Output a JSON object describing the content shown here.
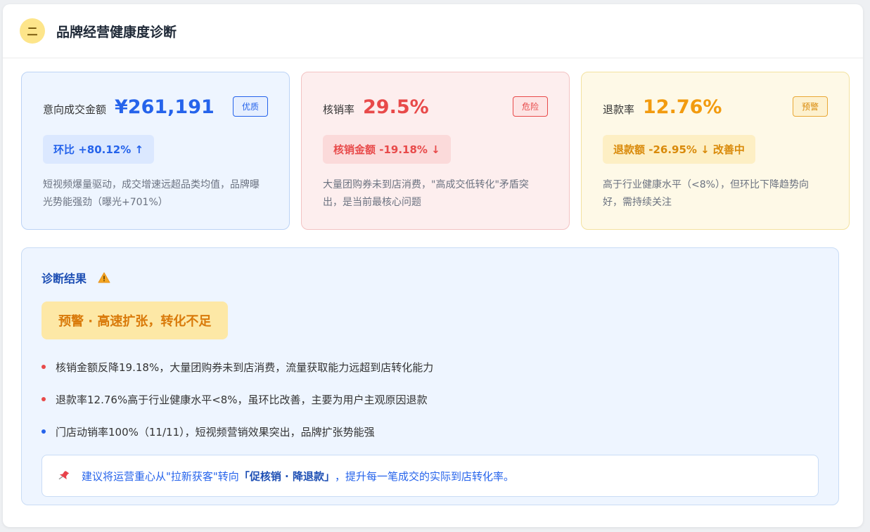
{
  "header": {
    "section_number": "二",
    "title": "品牌经营健康度诊断"
  },
  "cards": [
    {
      "label": "意向成交金额",
      "value": "¥261,191",
      "tag": "优质",
      "chip": "环比 +80.12% ↑",
      "description": "短视频爆量驱动，成交增速远超品类均值，品牌曝光势能强劲（曝光+701%）",
      "color": "#2563eb"
    },
    {
      "label": "核销率",
      "value": "29.5%",
      "tag": "危险",
      "chip": "核销金额 -19.18% ↓",
      "description": "大量团购券未到店消费，\"高成交低转化\"矛盾突出，是当前最核心问题",
      "color": "#e84a4a"
    },
    {
      "label": "退款率",
      "value": "12.76%",
      "tag": "预警",
      "chip": "退款额 -26.95% ↓ 改善中",
      "description": "高于行业健康水平（<8%），但环比下降趋势向好，需持续关注",
      "color": "#f29b0f"
    }
  ],
  "diagnosis": {
    "title": "诊断结果",
    "verdict": "预警 · 高速扩张，转化不足",
    "points": [
      {
        "text": "核销金额反降19.18%，大量团购券未到店消费，流量获取能力远超到店转化能力",
        "level": "red"
      },
      {
        "text": "退款率12.76%高于行业健康水平<8%，虽环比改善，主要为用户主观原因退款",
        "level": "red"
      },
      {
        "text": "门店动销率100%（11/11），短视频营销效果突出，品牌扩张势能强",
        "level": "blue"
      }
    ],
    "advice_prefix": "建议将运营重心从\"拉新获客\"转向",
    "advice_highlight": "「促核销 · 降退款」",
    "advice_suffix": "，提升每一笔成交的实际到店转化率。"
  }
}
